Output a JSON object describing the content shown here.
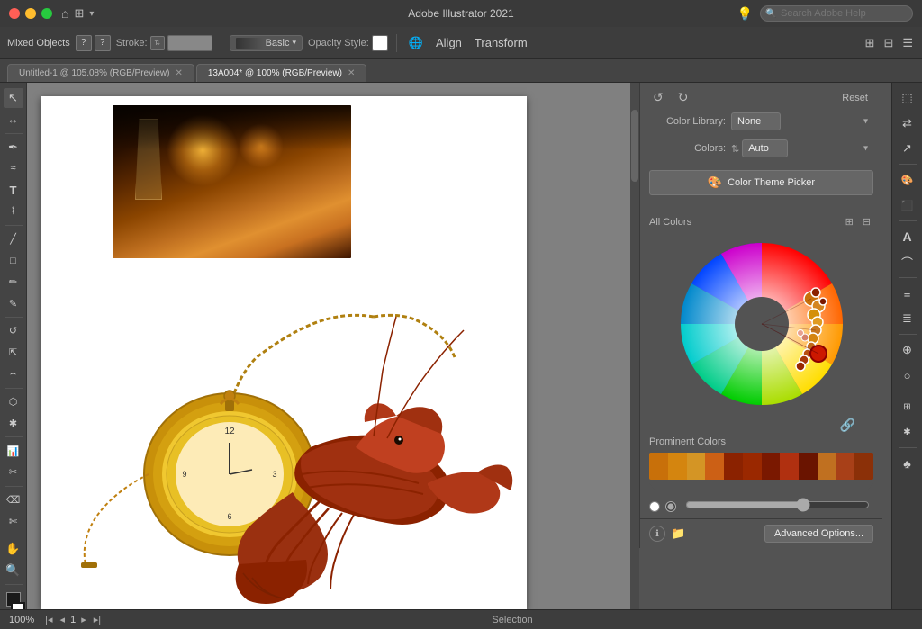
{
  "app": {
    "title": "Adobe Illustrator 2021",
    "window_controls": {
      "close": "×",
      "minimize": "–",
      "maximize": "□"
    }
  },
  "search": {
    "placeholder": "Search Adobe Help",
    "icon": "🔍"
  },
  "toolbar": {
    "object_type": "Mixed Objects",
    "question_mark1": "?",
    "question_mark2": "?",
    "stroke_label": "Stroke:",
    "mode_label": "Basic",
    "opacity_label": "Opacity",
    "style_label": "Style:",
    "align_label": "Align",
    "transform_label": "Transform"
  },
  "tabs": [
    {
      "id": "tab1",
      "label": "Untitled-1 @ 105.08% (RGB/Preview)",
      "active": false
    },
    {
      "id": "tab2",
      "label": "13A004* @ 100% (RGB/Preview)",
      "active": true
    }
  ],
  "color_panel": {
    "undo_symbol": "↺",
    "redo_symbol": "↻",
    "reset_label": "Reset",
    "color_library_label": "Color Library:",
    "color_library_value": "None",
    "colors_label": "Colors:",
    "colors_value": "Auto",
    "color_theme_btn": "Color Theme Picker",
    "all_colors_label": "All Colors",
    "lock_symbol": "🔗",
    "prominent_label": "Prominent Colors",
    "advanced_btn": "Advanced Options...",
    "info_symbol": "ℹ",
    "folder_symbol": "📁",
    "swatches": [
      "#c8700a",
      "#d4850f",
      "#e09a20",
      "#c05010",
      "#a03808",
      "#8b2200",
      "#9a3510",
      "#7a2000",
      "#6b1800",
      "#5a1200",
      "#c85c1a",
      "#a04020"
    ]
  },
  "status_bar": {
    "zoom": "100%",
    "page": "1",
    "tool": "Selection"
  },
  "left_tools": [
    "↖",
    "↔",
    "✏",
    "✒",
    "⌂",
    "T",
    "∟",
    "✂",
    "⬚",
    "○",
    "↺",
    "✱",
    "⬛",
    "⊗",
    "☁",
    "✋",
    "🔍"
  ],
  "right_panel_icons": [
    "⬚",
    "⇄",
    "↗",
    "≡",
    "A",
    "⌒",
    "¶",
    "≣",
    "⊕",
    "○",
    "⬛",
    "✱",
    "♣"
  ]
}
